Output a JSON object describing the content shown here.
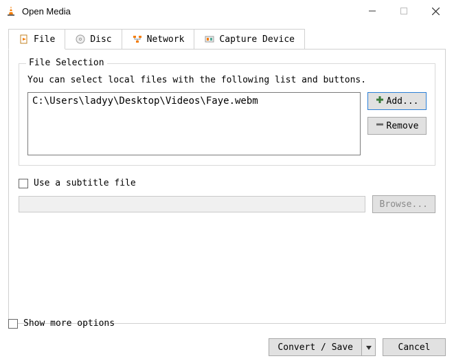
{
  "window": {
    "title": "Open Media"
  },
  "tabs": {
    "file": "File",
    "disc": "Disc",
    "network": "Network",
    "capture": "Capture Device"
  },
  "file_selection": {
    "legend": "File Selection",
    "desc": "You can select local files with the following list and buttons.",
    "items": [
      "C:\\Users\\ladyy\\Desktop\\Videos\\Faye.webm"
    ],
    "add_label": "Add...",
    "remove_label": "Remove"
  },
  "subtitle": {
    "checkbox_label": "Use a subtitle file",
    "path": "",
    "browse_label": "Browse..."
  },
  "bottom": {
    "show_more_label": "Show more options",
    "convert_label": "Convert / Save",
    "cancel_label": "Cancel"
  }
}
